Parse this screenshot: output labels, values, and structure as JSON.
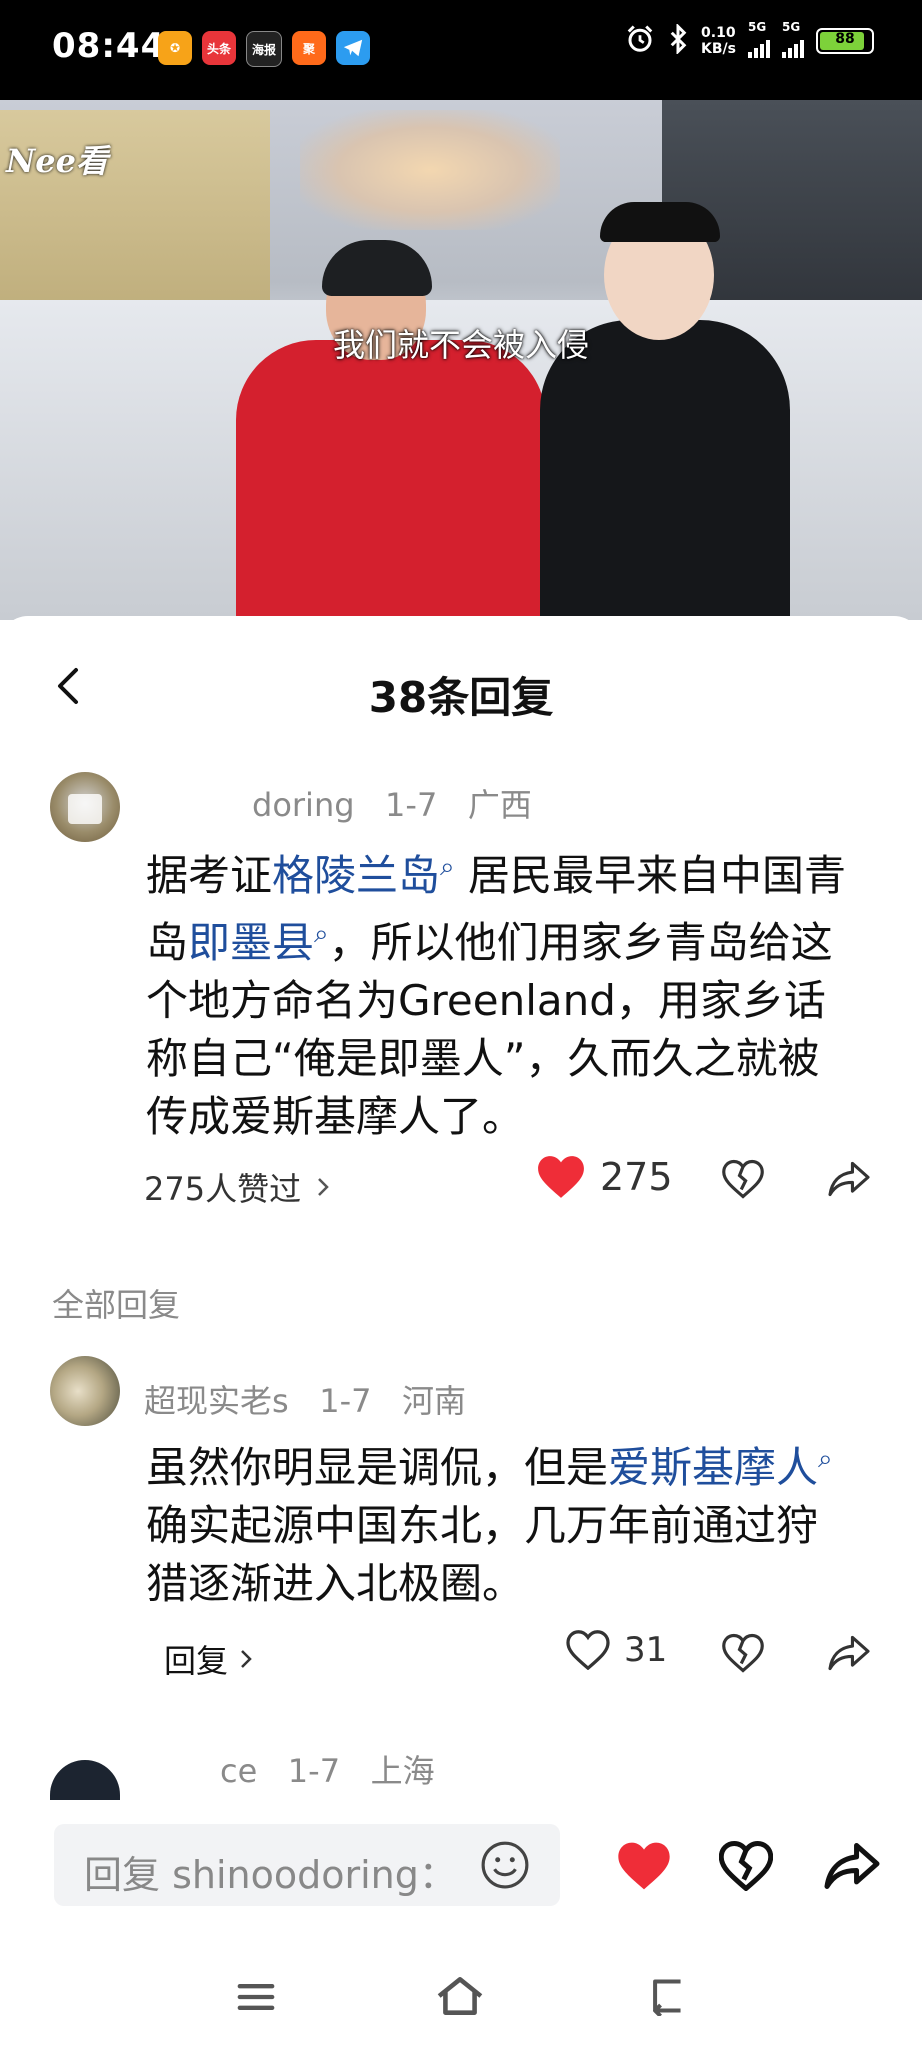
{
  "status_bar": {
    "time": "08:44",
    "apps": [
      "头条",
      "海报",
      "聚"
    ],
    "net_speed_value": "0.10",
    "net_speed_unit": "KB/s",
    "signal1_label": "5G",
    "signal2_label": "5G",
    "battery_level": "88",
    "battery_color": "#7dd23a"
  },
  "video": {
    "watermark": "Nee看",
    "subtitle": "我们就不会被入侵"
  },
  "sheet": {
    "title": "38条回复"
  },
  "main_comment": {
    "author": "doring",
    "date": "1-7",
    "location": "广西",
    "text": {
      "p1": "据考证",
      "link1": "格陵兰岛",
      "p2": " 居民最早来自中国青岛",
      "link2": "即墨县",
      "p3": "，所以他们用家乡青岛给这个地方命名为Greenland，用家乡话称自己“俺是即墨人”，久而久之就被传成爱斯基摩人了。"
    },
    "likes_text": "275人赞过",
    "like_count": "275"
  },
  "section_label": "全部回复",
  "reply1": {
    "author": "超现实老s",
    "date": "1-7",
    "location": "河南",
    "text": {
      "p1": "虽然你明显是调侃，但是",
      "link1": "爱斯基摩人",
      "p2": " 确实起源中国东北，几万年前通过狩猎逐渐进入北极圈。"
    },
    "reply_label": "回复",
    "like_count": "31"
  },
  "reply2": {
    "author": "ce",
    "date": "1-7",
    "location": "上海"
  },
  "input": {
    "placeholder": "回复 shinoodoring："
  },
  "colors": {
    "heart_red": "#ef2d38",
    "link_blue": "#1f4e9c"
  }
}
